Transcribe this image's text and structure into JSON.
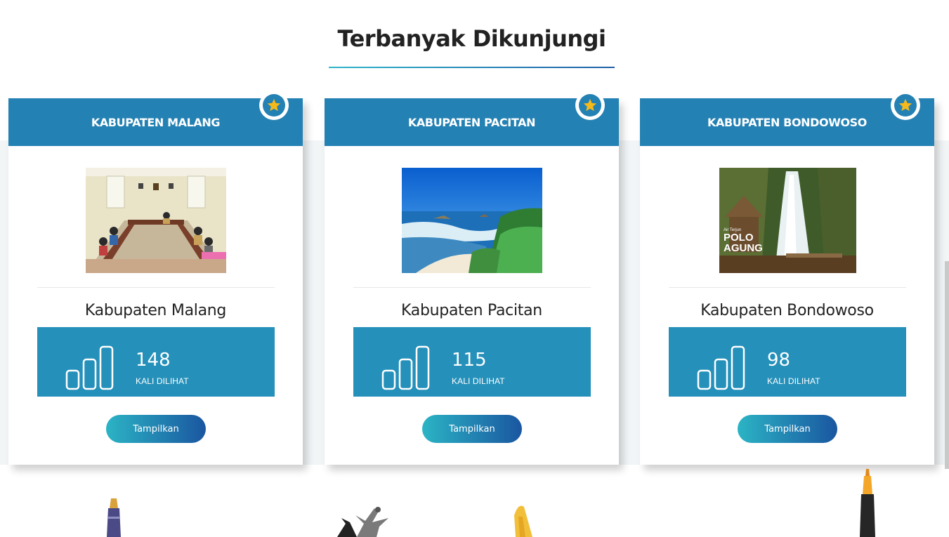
{
  "section": {
    "title": "Terbanyak Dikunjungi"
  },
  "cards": [
    {
      "header": "KABUPATEN MALANG",
      "name": "Kabupaten Malang",
      "views": "148",
      "views_label": "KALI DILIHAT",
      "button": "Tampilkan",
      "photo": "meeting-room-photo"
    },
    {
      "header": "KABUPATEN PACITAN",
      "name": "Kabupaten Pacitan",
      "views": "115",
      "views_label": "KALI DILIHAT",
      "button": "Tampilkan",
      "photo": "beach-photo"
    },
    {
      "header": "KABUPATEN BONDOWOSO",
      "name": "Kabupaten Bondowoso",
      "views": "98",
      "views_label": "KALI DILIHAT",
      "button": "Tampilkan",
      "photo": "waterfall-photo",
      "photo_text": [
        "Air Terjun",
        "POLO",
        "AGUNG"
      ]
    }
  ],
  "colors": {
    "header": "#2481b3",
    "stat": "#2590ba",
    "star": "#f6b91a"
  }
}
